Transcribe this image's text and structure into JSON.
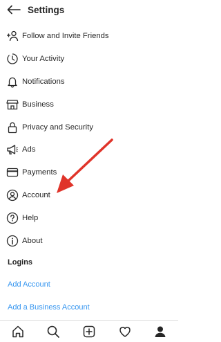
{
  "header": {
    "title": "Settings"
  },
  "menu": [
    {
      "label": "Follow and Invite Friends",
      "icon": "add-person-icon"
    },
    {
      "label": "Your Activity",
      "icon": "activity-clock-icon"
    },
    {
      "label": "Notifications",
      "icon": "bell-icon"
    },
    {
      "label": "Business",
      "icon": "storefront-icon"
    },
    {
      "label": "Privacy and Security",
      "icon": "lock-icon"
    },
    {
      "label": "Ads",
      "icon": "megaphone-icon"
    },
    {
      "label": "Payments",
      "icon": "card-icon"
    },
    {
      "label": "Account",
      "icon": "person-circle-icon"
    },
    {
      "label": "Help",
      "icon": "question-circle-icon"
    },
    {
      "label": "About",
      "icon": "info-circle-icon"
    }
  ],
  "logins": {
    "heading": "Logins",
    "add_account": "Add Account",
    "add_business_account": "Add a Business Account"
  },
  "tabbar": [
    "home-icon",
    "search-icon",
    "new-post-icon",
    "heart-icon",
    "profile-icon"
  ],
  "colors": {
    "link": "#3897f0",
    "arrow": "#e0342a",
    "text": "#262626"
  }
}
